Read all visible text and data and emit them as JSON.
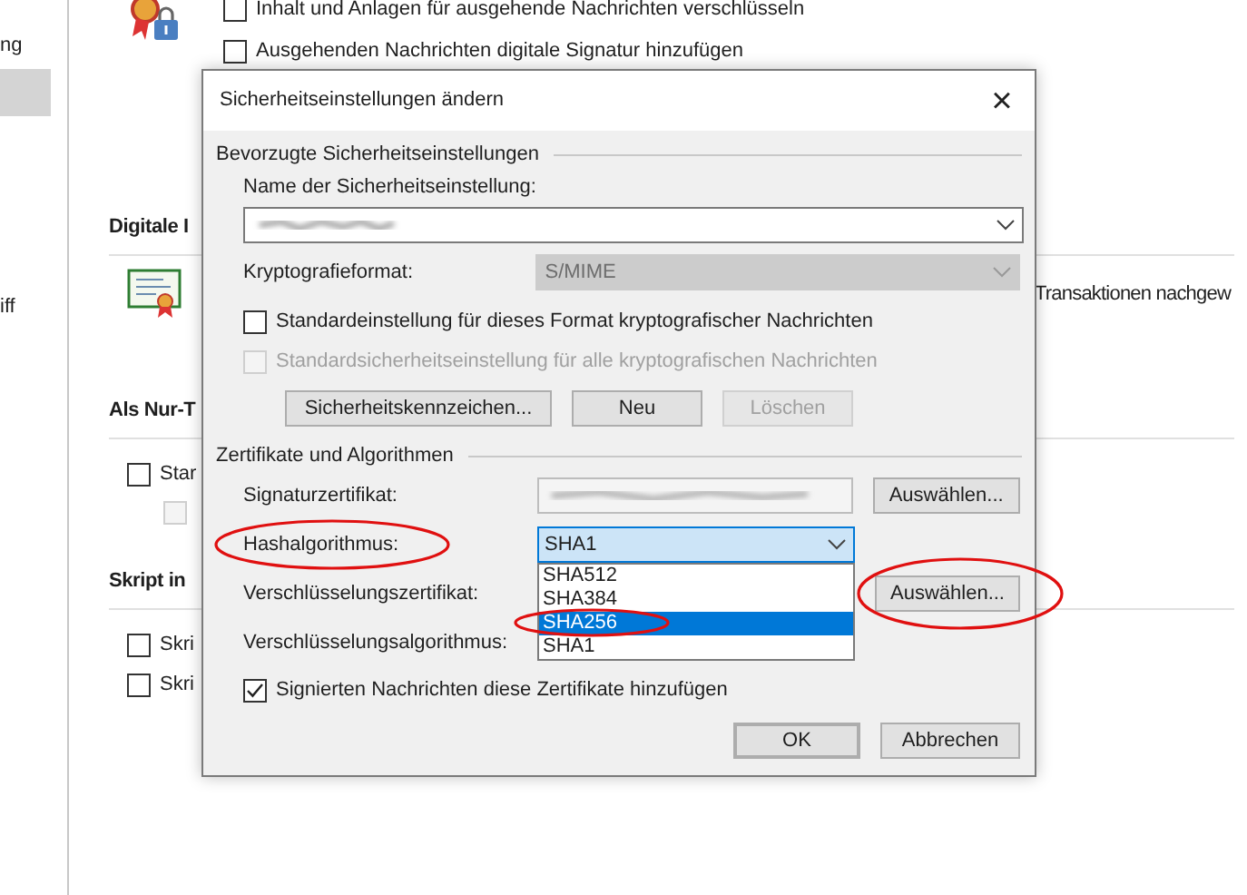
{
  "sidebar": {
    "items": [
      {
        "label": "ng",
        "selected": false
      },
      {
        "selected": true
      },
      {
        "label": "iff",
        "selected": false
      }
    ]
  },
  "top_options": [
    {
      "label": "Inhalt und Anlagen für ausgehende Nachrichten verschlüsseln",
      "checked": false
    },
    {
      "label": "Ausgehenden Nachrichten digitale Signatur hinzufügen",
      "checked": false
    }
  ],
  "sections": [
    {
      "title": "Digitale I",
      "side_text": "Transaktionen nachgew"
    },
    {
      "title": "Als Nur-T",
      "options": [
        {
          "label": "Star",
          "checked": false,
          "disabled": false
        },
        {
          "checked": false,
          "disabled": true
        }
      ]
    },
    {
      "title": "Skript in",
      "options": [
        {
          "label": "Skri",
          "checked": false,
          "disabled": false
        },
        {
          "label": "Skri",
          "checked": false,
          "disabled": false
        }
      ]
    }
  ],
  "dialog": {
    "title": "Sicherheitseinstellungen ändern",
    "close": "×",
    "group_1": {
      "title": "Bevorzugte Sicherheitseinstellungen",
      "name_label": "Name der Sicherheitseinstellung:",
      "format_label": "Kryptografieformat:",
      "format_value": "S/MIME",
      "format_disabled": true,
      "checkboxes": [
        {
          "label": "Standardeinstellung für dieses Format kryptografischer Nachrichten",
          "checked": false,
          "disabled": false
        },
        {
          "label": "Standardsicherheitseinstellung für alle kryptografischen Nachrichten",
          "checked": false,
          "disabled": true
        }
      ],
      "buttons": [
        {
          "label": "Sicherheitskennzeichen...",
          "disabled": false
        },
        {
          "label": "Neu",
          "disabled": false
        },
        {
          "label": "Löschen",
          "disabled": true
        }
      ]
    },
    "group_2": {
      "title": "Zertifikate und Algorithmen",
      "signature_label": "Signaturzertifikat:",
      "signature_button": "Auswählen...",
      "hash_label": "Hashalgorithmus:",
      "hash_value": "SHA1",
      "hash_options": [
        {
          "label": "SHA512",
          "selected": false
        },
        {
          "label": "SHA384",
          "selected": false
        },
        {
          "label": "SHA256",
          "selected": true
        },
        {
          "label": "SHA1",
          "selected": false
        }
      ],
      "encryption_label": "Verschlüsselungszertifikat:",
      "encryption_button": "Auswählen...",
      "algorithm_label": "Verschlüsselungsalgorithmus:",
      "attach_checkbox": {
        "label": "Signierten Nachrichten diese Zertifikate hinzufügen",
        "checked": true
      }
    },
    "buttons": [
      {
        "label": "OK",
        "default": true
      },
      {
        "label": "Abbrechen",
        "default": false
      }
    ]
  }
}
